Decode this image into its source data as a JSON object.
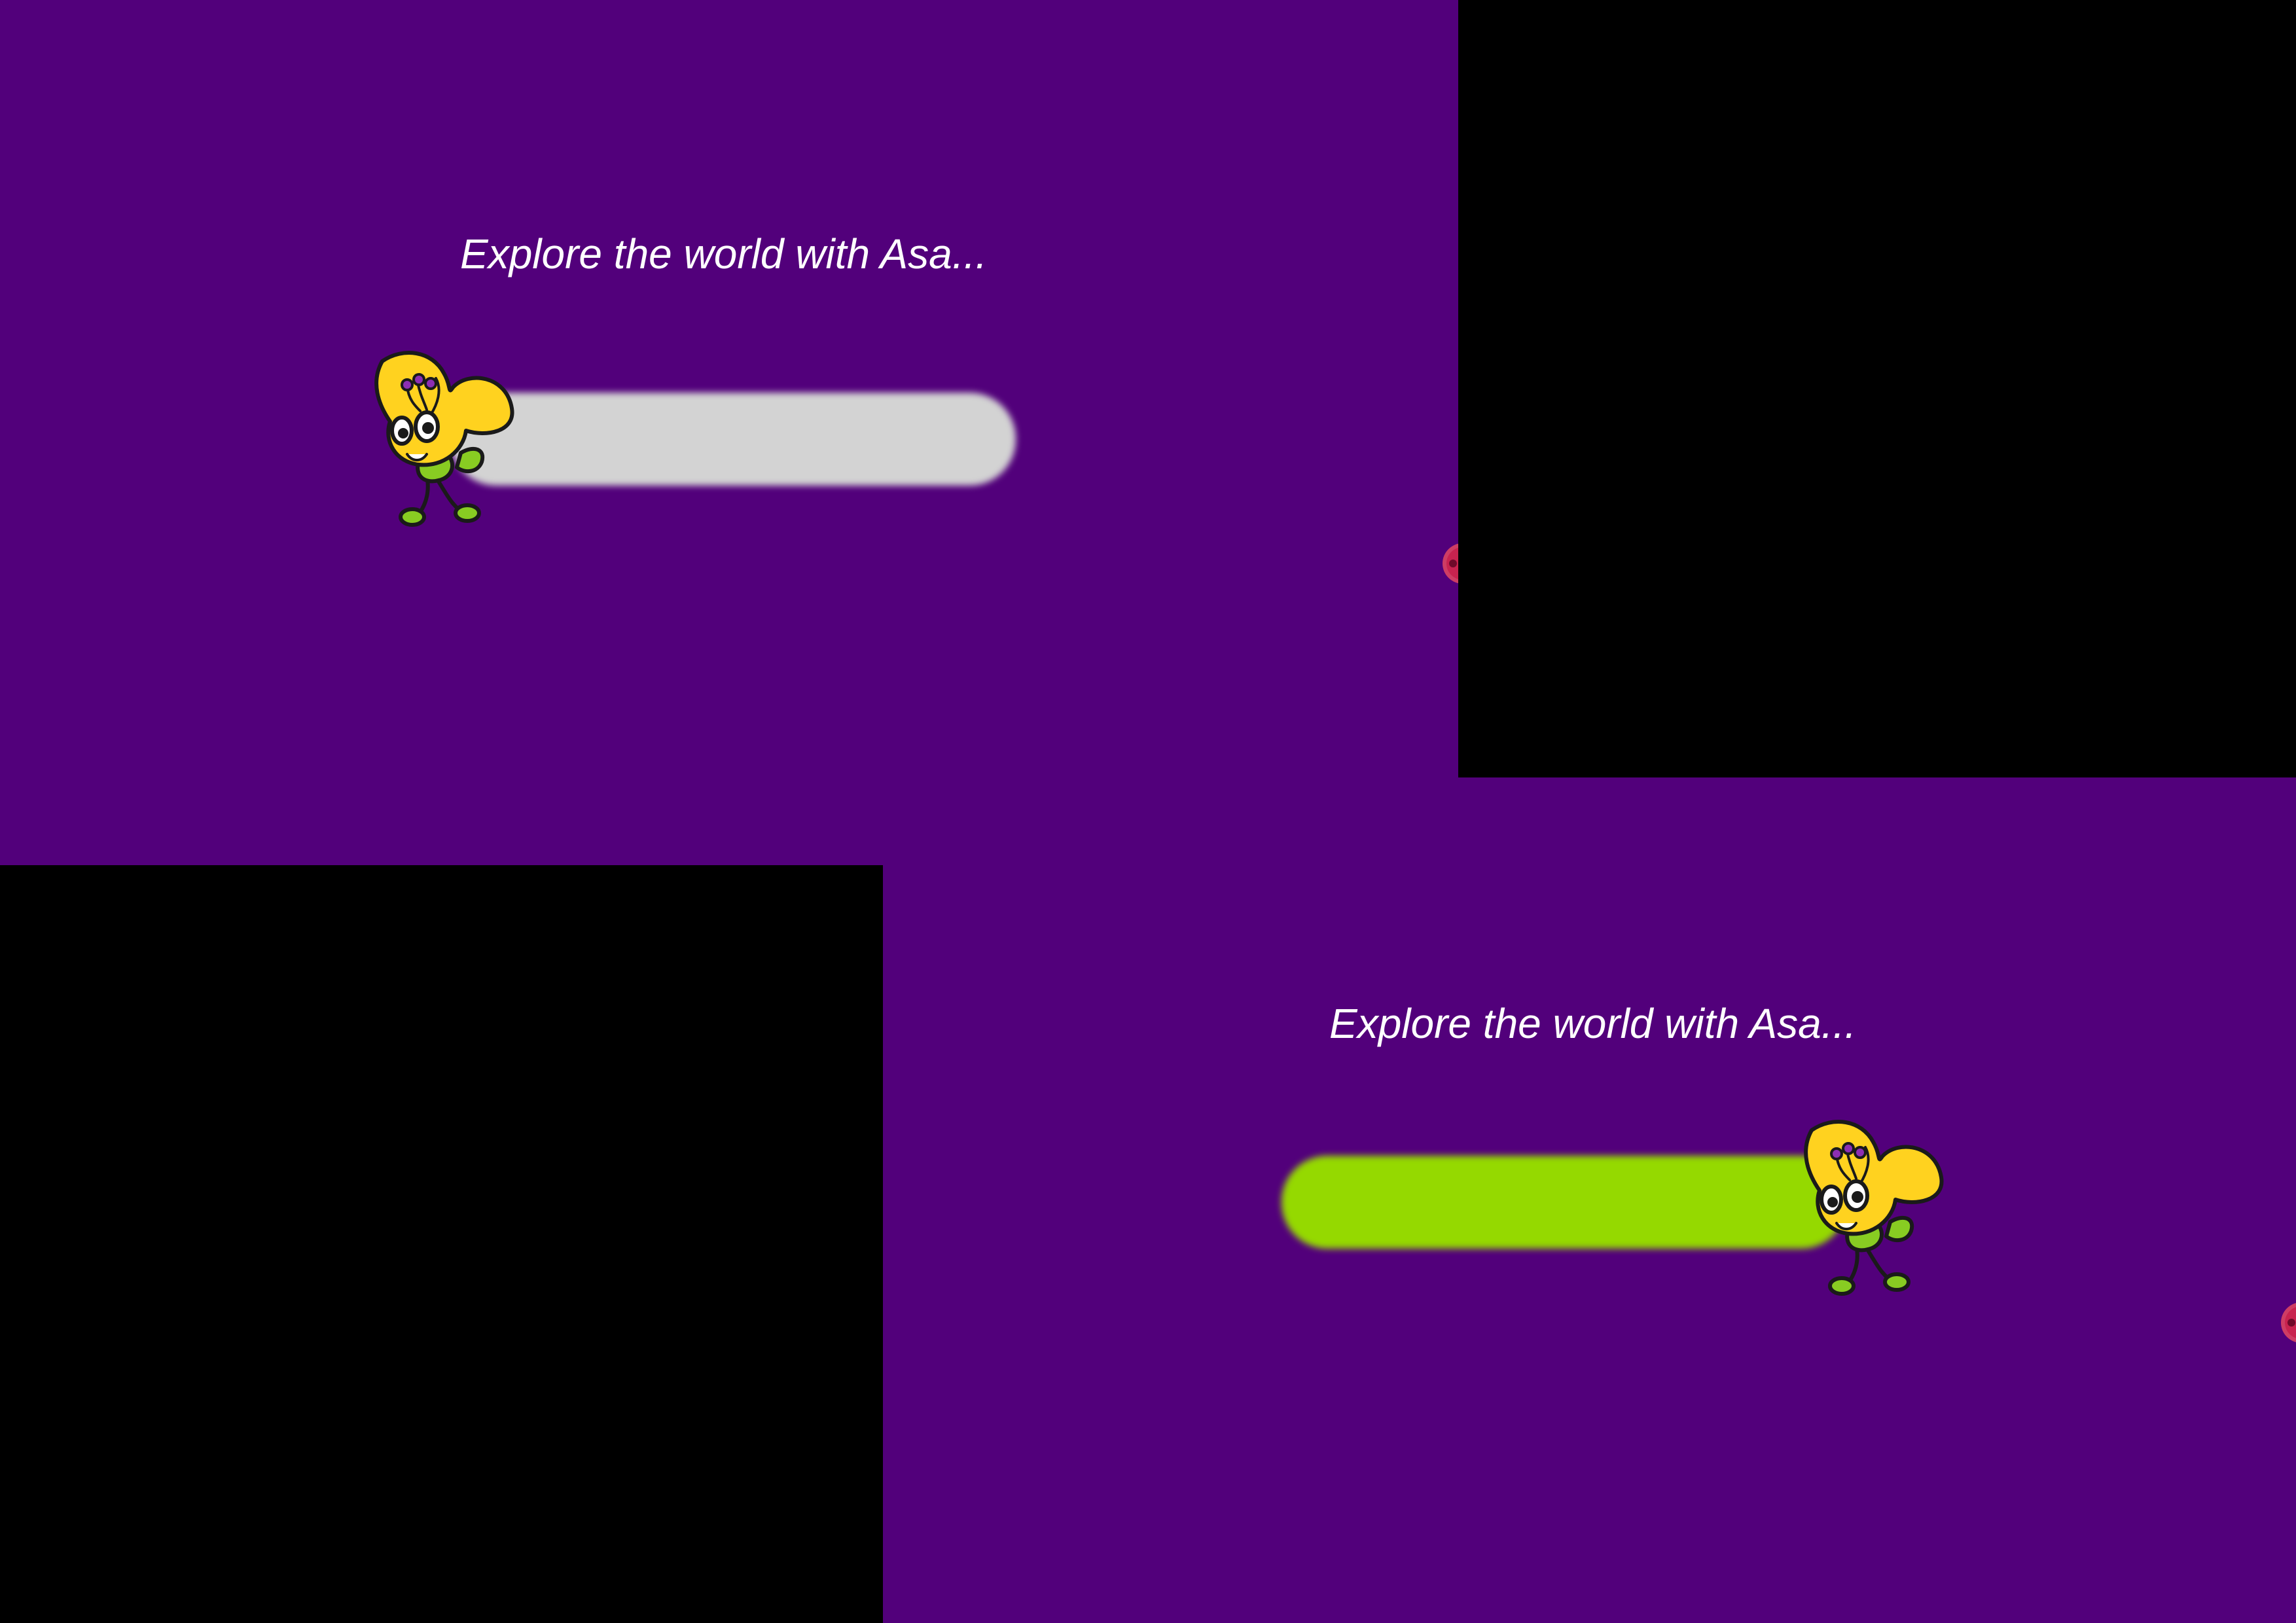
{
  "screens": [
    {
      "tagline": "Explore the world with Asa...",
      "progress": 0.0,
      "mascot_icon": "asa-butterfly-mascot-icon",
      "next_icon": "next-arrow-icon",
      "colors": {
        "background": "#52007b",
        "track": "#d3d3d3",
        "fill": "#95d900",
        "text": "#ffffff"
      }
    },
    {
      "tagline": "Explore the world with Asa...",
      "progress": 1.0,
      "mascot_icon": "asa-butterfly-mascot-icon",
      "next_icon": "next-arrow-icon",
      "colors": {
        "background": "#52007b",
        "track": "#d3d3d3",
        "fill": "#95d900",
        "text": "#ffffff"
      }
    }
  ],
  "colors": {
    "letterbox": "#000000"
  }
}
